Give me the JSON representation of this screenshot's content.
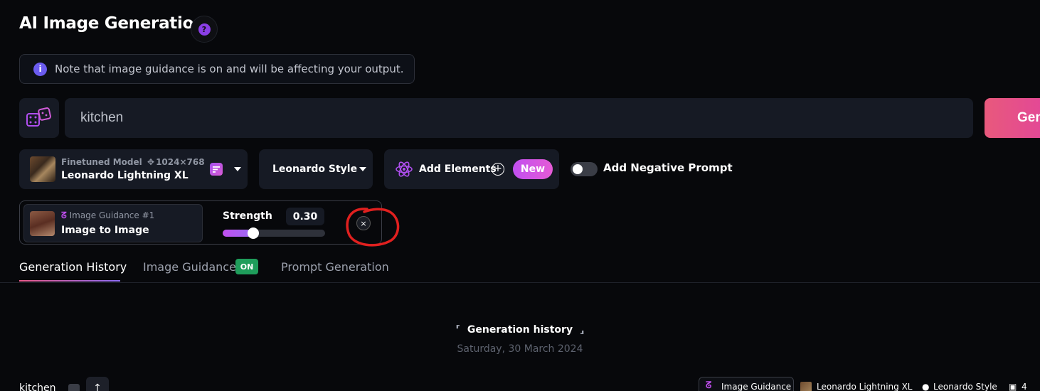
{
  "header": {
    "title": "AI Image Generation",
    "help_glyph": "?"
  },
  "notice": {
    "info_glyph": "i",
    "text": "Note that image guidance is on and will be affecting your output."
  },
  "prompt": {
    "value": "kitchen",
    "placeholder": "",
    "generate_label": "Generate"
  },
  "model": {
    "sublabel": "Finetuned Model",
    "dimensions": "1024×768",
    "name": "Leonardo Lightning XL"
  },
  "style": {
    "label": "Leonardo Style"
  },
  "elements": {
    "label": "Add Elements",
    "new_badge": "New"
  },
  "negative_prompt": {
    "label": "Add Negative Prompt",
    "enabled": false
  },
  "image_guidance": {
    "sublabel": "Image Guidance #1",
    "type": "Image to Image",
    "strength_label": "Strength",
    "strength_value": "0.30",
    "strength_fraction": 0.3,
    "close_glyph": "×"
  },
  "tabs": [
    {
      "label": "Generation History",
      "active": true
    },
    {
      "label": "Image Guidance",
      "badge": "ON"
    },
    {
      "label": "Prompt Generation"
    }
  ],
  "history": {
    "title": "Generation history",
    "date": "Saturday, 30 March 2024",
    "row": {
      "prompt": "kitchen",
      "chip_label": "Image Guidance",
      "model": "Leonardo Lightning XL",
      "style": "Leonardo Style",
      "count": "4"
    }
  },
  "colors": {
    "accent": "#c14ff0",
    "generate_gradient_start": "#e8597c",
    "on_badge": "#1f9d5b",
    "annotation": "#e0201f"
  }
}
